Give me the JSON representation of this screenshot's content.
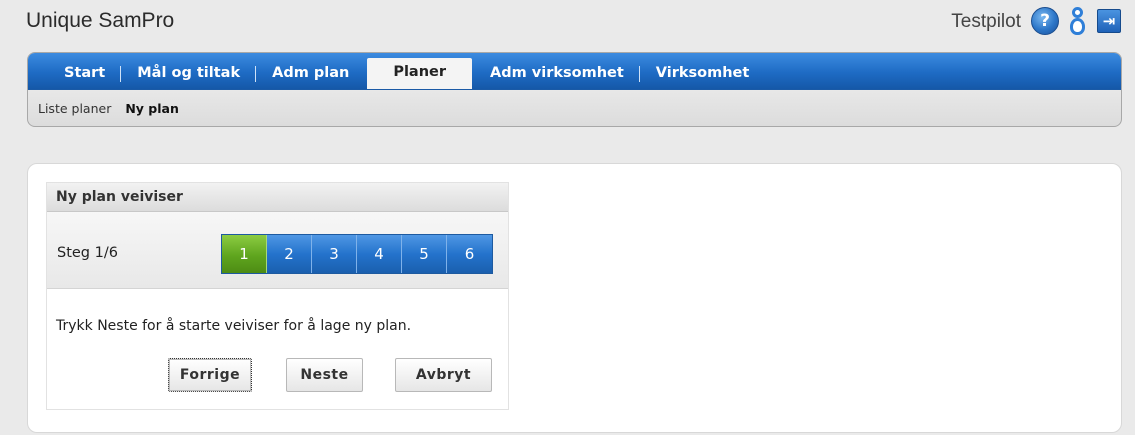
{
  "app": {
    "title": "Unique SamPro"
  },
  "user": {
    "name": "Testpilot",
    "help_glyph": "?",
    "icons": [
      "help-icon",
      "user-icon",
      "logout-icon"
    ]
  },
  "nav": {
    "tabs": [
      {
        "label": "Start",
        "active": false
      },
      {
        "label": "Mål og tiltak",
        "active": false
      },
      {
        "label": "Adm plan",
        "active": false
      },
      {
        "label": "Planer",
        "active": true
      },
      {
        "label": "Adm virksomhet",
        "active": false
      },
      {
        "label": "Virksomhet",
        "active": false
      }
    ],
    "subnav": [
      {
        "label": "Liste planer",
        "active": false
      },
      {
        "label": "Ny plan",
        "active": true
      }
    ]
  },
  "wizard": {
    "title": "Ny plan veiviser",
    "step_label": "Steg 1/6",
    "steps": [
      "1",
      "2",
      "3",
      "4",
      "5",
      "6"
    ],
    "current_step": 1,
    "message": "Trykk Neste for å starte veiviser for å lage ny plan.",
    "buttons": {
      "prev": "Forrige",
      "next": "Neste",
      "cancel": "Avbryt"
    }
  },
  "colors": {
    "nav_blue": "#1e6bc4",
    "step_blue": "#2473cc",
    "step_active_green": "#5fa51e"
  }
}
